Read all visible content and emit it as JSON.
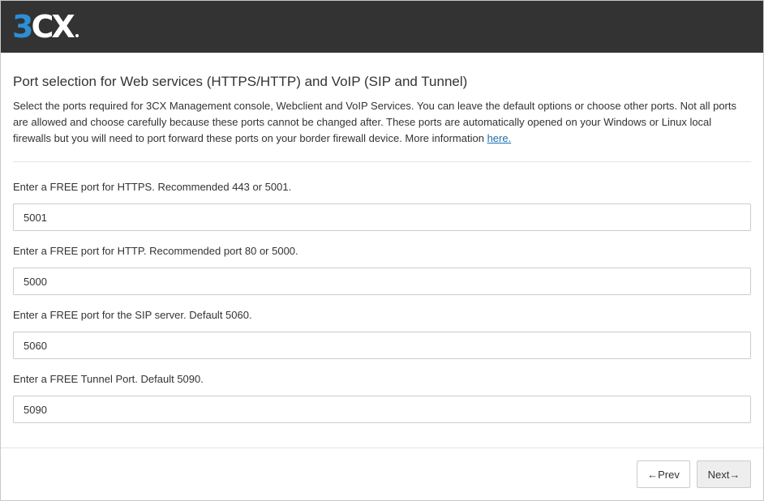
{
  "header": {
    "logo": {
      "part1": "3",
      "part2": "C",
      "part3": "X"
    }
  },
  "main": {
    "title": "Port selection for Web services (HTTPS/HTTP) and VoIP (SIP and Tunnel)",
    "intro_text": "Select the ports required for 3CX Management console, Webclient and VoIP Services. You can leave the default options or choose other ports. Not all ports are allowed and choose carefully because these ports cannot be changed after. These ports are automatically opened on your Windows or Linux local firewalls but you will need to port forward these ports on your border firewall device. More information ",
    "more_info_link": "here.",
    "fields": [
      {
        "label": "Enter a FREE port for HTTPS. Recommended 443 or 5001.",
        "value": "5001"
      },
      {
        "label": "Enter a FREE port for HTTP. Recommended port 80 or 5000.",
        "value": "5000"
      },
      {
        "label": "Enter a FREE port for the SIP server. Default 5060.",
        "value": "5060"
      },
      {
        "label": "Enter a FREE Tunnel Port. Default 5090.",
        "value": "5090"
      }
    ]
  },
  "footer": {
    "prev_label": "←Prev",
    "next_label": "Next→"
  },
  "colors": {
    "header_bg": "#333333",
    "logo_accent": "#2d8ed4",
    "link": "#1a6fb0"
  }
}
